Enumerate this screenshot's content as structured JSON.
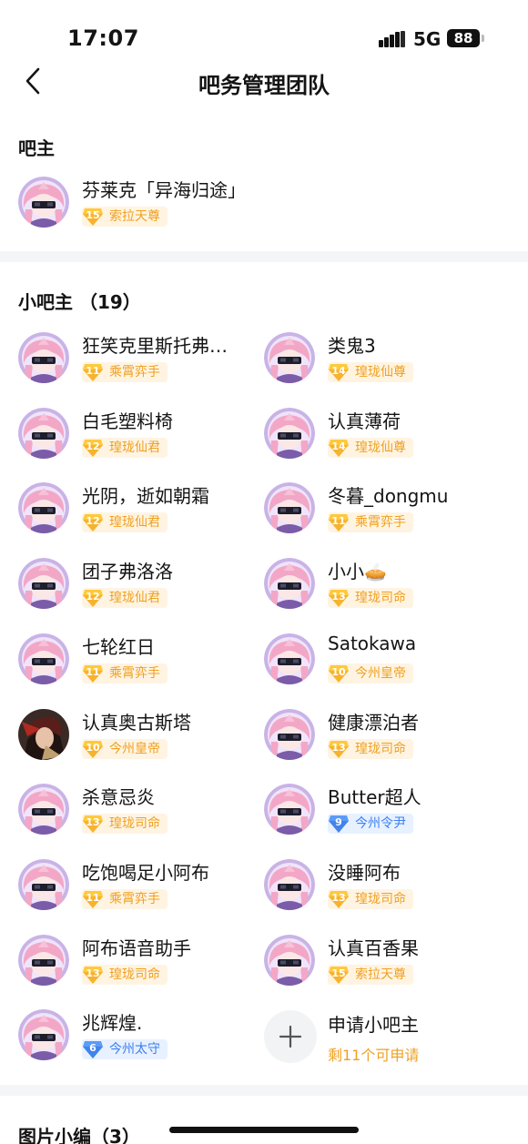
{
  "status_bar": {
    "time": "17:07",
    "network": "5G",
    "battery": "88"
  },
  "nav": {
    "title": "吧务管理团队"
  },
  "owner_section": {
    "title": "吧主",
    "member": {
      "name": "芬莱克「异海归途」",
      "level": "15",
      "rank": "索拉天尊",
      "badge_style": "orange"
    }
  },
  "mods_section": {
    "title": "小吧主 （19）",
    "members": [
      {
        "name": "狂笑克里斯托弗…",
        "level": "11",
        "rank": "乘霄弈手",
        "badge_style": "orange",
        "avatar": "pink"
      },
      {
        "name": "类鬼3",
        "level": "14",
        "rank": "瑝珑仙尊",
        "badge_style": "orange",
        "avatar": "pink"
      },
      {
        "name": "白毛塑料椅",
        "level": "12",
        "rank": "瑝珑仙君",
        "badge_style": "orange",
        "avatar": "pink"
      },
      {
        "name": "认真薄荷",
        "level": "14",
        "rank": "瑝珑仙尊",
        "badge_style": "orange",
        "avatar": "pink"
      },
      {
        "name": "光阴，逝如朝霜",
        "level": "12",
        "rank": "瑝珑仙君",
        "badge_style": "orange",
        "avatar": "pink"
      },
      {
        "name": "冬暮_dongmu",
        "level": "11",
        "rank": "乘霄弈手",
        "badge_style": "orange",
        "avatar": "pink"
      },
      {
        "name": "团子弗洛洛",
        "level": "12",
        "rank": "瑝珑仙君",
        "badge_style": "orange",
        "avatar": "pink"
      },
      {
        "name": "小小🥧",
        "level": "13",
        "rank": "瑝珑司命",
        "badge_style": "orange",
        "avatar": "pink"
      },
      {
        "name": "七轮红日",
        "level": "11",
        "rank": "乘霄弈手",
        "badge_style": "orange",
        "avatar": "pink"
      },
      {
        "name": "Satokawa",
        "level": "10",
        "rank": "今州皇帝",
        "badge_style": "orange",
        "avatar": "pink"
      },
      {
        "name": "认真奥古斯塔",
        "level": "10",
        "rank": "今州皇帝",
        "badge_style": "orange",
        "avatar": "dark"
      },
      {
        "name": "健康漂泊者",
        "level": "13",
        "rank": "瑝珑司命",
        "badge_style": "orange",
        "avatar": "pink"
      },
      {
        "name": "杀意忌炎",
        "level": "13",
        "rank": "瑝珑司命",
        "badge_style": "orange",
        "avatar": "pink"
      },
      {
        "name": "Butter超人",
        "level": "9",
        "rank": "今州令尹",
        "badge_style": "blue",
        "avatar": "pink"
      },
      {
        "name": "吃饱喝足小阿布",
        "level": "11",
        "rank": "乘霄弈手",
        "badge_style": "orange",
        "avatar": "pink"
      },
      {
        "name": "没睡阿布",
        "level": "13",
        "rank": "瑝珑司命",
        "badge_style": "orange",
        "avatar": "pink"
      },
      {
        "name": "阿布语音助手",
        "level": "13",
        "rank": "瑝珑司命",
        "badge_style": "orange",
        "avatar": "pink"
      },
      {
        "name": "认真百香果",
        "level": "15",
        "rank": "索拉天尊",
        "badge_style": "orange",
        "avatar": "pink"
      },
      {
        "name": "兆辉煌.",
        "level": "6",
        "rank": "今州太守",
        "badge_style": "blue",
        "avatar": "pink"
      }
    ],
    "apply": {
      "label": "申请小吧主",
      "sub": "剩11个可申请"
    }
  },
  "editors_section": {
    "title": "图片小编（3）"
  },
  "colors": {
    "badge_orange": "#f0a020",
    "badge_blue": "#3b7ff2",
    "divider": "#f4f5f7"
  },
  "icons": {
    "back": "chevron-left-icon",
    "add": "plus-icon"
  }
}
